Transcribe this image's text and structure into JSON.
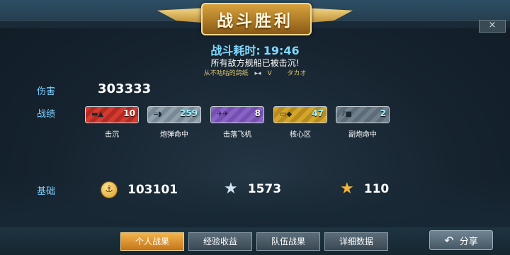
{
  "header": {
    "title": "战斗胜利",
    "close_icon": "×"
  },
  "battle": {
    "time_label": "战斗耗时:",
    "time_value": "19:46",
    "message": "所有敌方舰船已被击沉!",
    "player_left": "从不咕咕的鸽纸",
    "versus": "V",
    "player_right": "タカオ"
  },
  "damage": {
    "label": "伤害",
    "value": "303333"
  },
  "achievements": {
    "label": "战绩",
    "items": [
      {
        "name": "击沉",
        "count": "10",
        "icon": "ship-icon",
        "color": "#d43b2f"
      },
      {
        "name": "炮弹命中",
        "count": "259",
        "icon": "shell-icon",
        "color": "#8fa0ac"
      },
      {
        "name": "击落飞机",
        "count": "8",
        "icon": "plane-icon",
        "color": "#8a62c7"
      },
      {
        "name": "核心区",
        "count": "47",
        "icon": "core-icon",
        "color": "#d3a52a"
      },
      {
        "name": "副炮命中",
        "count": "2",
        "icon": "cannon-icon",
        "color": "#6f7f8b"
      }
    ]
  },
  "base": {
    "label": "基础",
    "gold": "103101",
    "silver_star": "1573",
    "gold_star": "110"
  },
  "tabs": [
    "个人战果",
    "经验收益",
    "队伍战果",
    "详细数据"
  ],
  "share_label": "分享"
}
